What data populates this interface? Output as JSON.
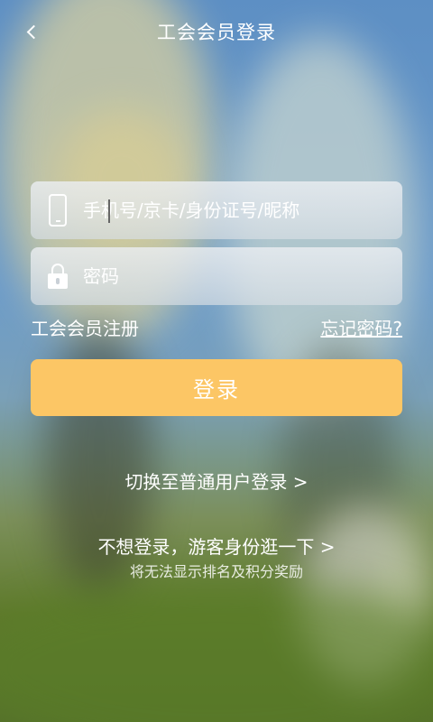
{
  "header": {
    "title": "工会会员登录"
  },
  "login_form": {
    "account_placeholder": "手机号/京卡/身份证号/昵称",
    "password_placeholder": "密码",
    "register_label": "工会会员注册",
    "forgot_label": "忘记密码?",
    "submit_label": "登录"
  },
  "footer": {
    "switch_label": "切换至普通用户登录 >",
    "guest_label": "不想登录，游客身份逛一下 >",
    "guest_note": "将无法显示排名及积分奖励"
  },
  "colors": {
    "accent": "#fcc665"
  },
  "icons": {
    "back": "chevron-left-icon",
    "account": "phone-icon",
    "password": "lock-icon"
  }
}
